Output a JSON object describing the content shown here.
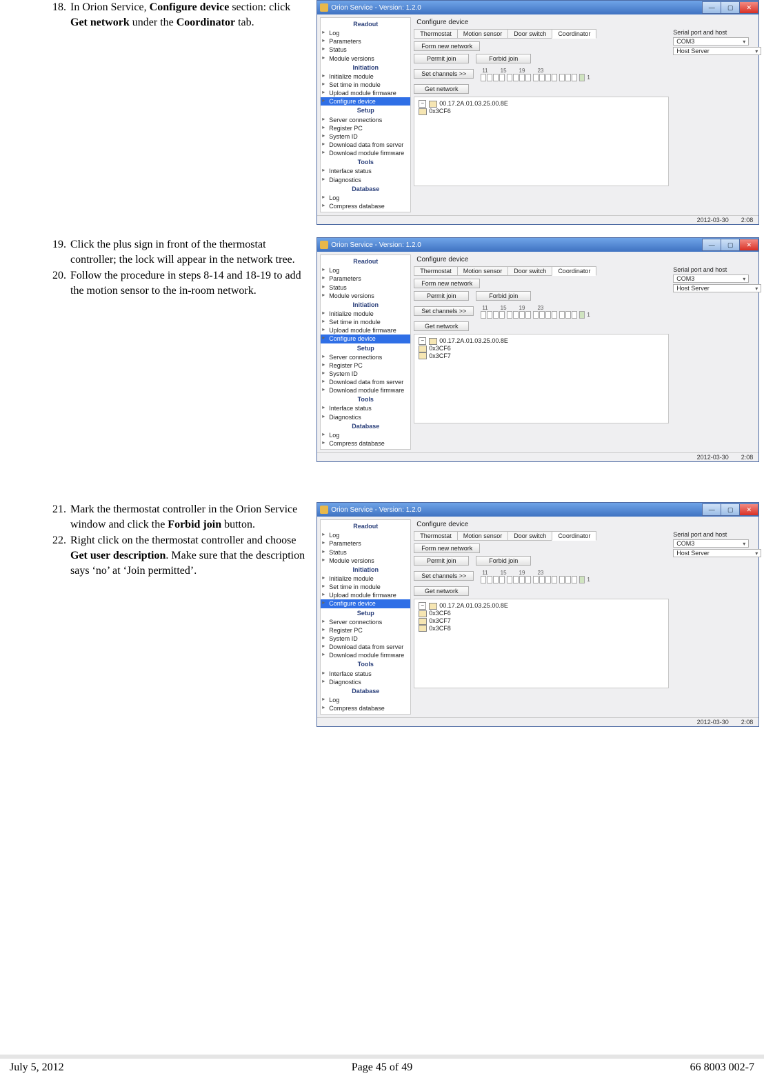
{
  "steps": {
    "s18": {
      "num": "18.",
      "t1": "In Orion Service, ",
      "b1": "Configure device",
      "t2": " section: click ",
      "b2": "Get network",
      "t3": " under the ",
      "b3": "Coordinator",
      "t4": " tab."
    },
    "s19": {
      "num": "19.",
      "text": "Click the plus sign in front of the thermostat controller; the lock will appear in the network tree."
    },
    "s20": {
      "num": "20.",
      "text": "Follow the procedure in steps 8-14 and 18-19 to add the motion sensor to the in-room network."
    },
    "s21": {
      "num": "21.",
      "t1": "Mark the thermostat controller in the Orion Service window and click the ",
      "b1": "Forbid join",
      "t2": " button."
    },
    "s22": {
      "num": "22.",
      "t1": "Right click on the thermostat controller and choose ",
      "b1": "Get user description",
      "t2": ". Make sure that the description says ‘no’ at ‘Join permitted’."
    }
  },
  "window": {
    "title": "Orion Service - Version: 1.2.0",
    "min": "—",
    "max": "▢",
    "close": "✕",
    "panel_title": "Configure device",
    "tabs": {
      "thermostat": "Thermostat",
      "motion": "Motion sensor",
      "door": "Door switch",
      "coordinator": "Coordinator"
    },
    "buttons": {
      "form": "Form new network",
      "permit": "Permit join",
      "forbid": "Forbid join",
      "setchan": "Set channels >>",
      "getnet": "Get network"
    },
    "channels": {
      "a": "11",
      "b": "15",
      "c": "19",
      "d": "23",
      "trail": "1"
    },
    "right": {
      "label": "Serial port and host",
      "com": "COM3",
      "host": "Host Server"
    },
    "sidebar": {
      "readout": "Readout",
      "log": "Log",
      "params": "Parameters",
      "status": "Status",
      "modver": "Module versions",
      "initiation": "Initiation",
      "initmod": "Initialize module",
      "settime": "Set time in module",
      "upfw": "Upload module firmware",
      "confdev": "Configure device",
      "setup": "Setup",
      "srvconn": "Server connections",
      "regpc": "Register PC",
      "sysid": "System ID",
      "dlserver": "Download data from server",
      "dlfw": "Download module firmware",
      "tools": "Tools",
      "ifstat": "Interface status",
      "diag": "Diagnostics",
      "database": "Database",
      "log2": "Log",
      "compress": "Compress database"
    },
    "tree": {
      "root": "00.17.2A.01.03.25.00.8E",
      "n1": "0x3CF6",
      "n2": "0x3CF7",
      "n3": "0x3CF8"
    },
    "status": {
      "date": "2012-03-30",
      "time": "2:08"
    }
  },
  "footer": {
    "left": "July 5, 2012",
    "center": "Page 45 of 49",
    "right": "66 8003 002-7"
  }
}
